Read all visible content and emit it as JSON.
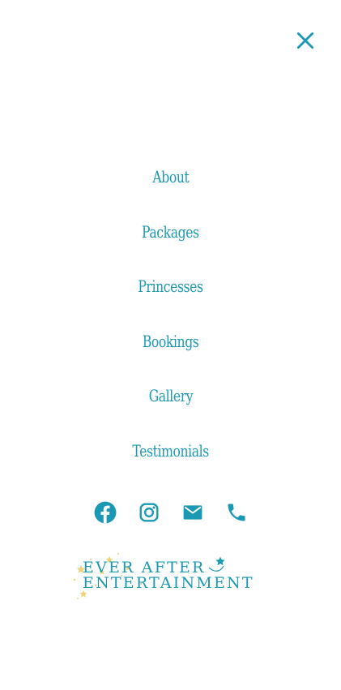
{
  "menu": {
    "close_icon": "close-icon",
    "items": [
      {
        "label": "About"
      },
      {
        "label": "Packages"
      },
      {
        "label": "Princesses"
      },
      {
        "label": "Bookings"
      },
      {
        "label": "Gallery"
      },
      {
        "label": "Testimonials"
      }
    ]
  },
  "social": {
    "icons": [
      "facebook-icon",
      "instagram-icon",
      "email-icon",
      "phone-icon"
    ]
  },
  "logo": {
    "line1": "EVER AFTER",
    "line2": "ENTERTAINMENT"
  },
  "colors": {
    "accent": "#1b98b4",
    "star": "#f0d27a"
  }
}
